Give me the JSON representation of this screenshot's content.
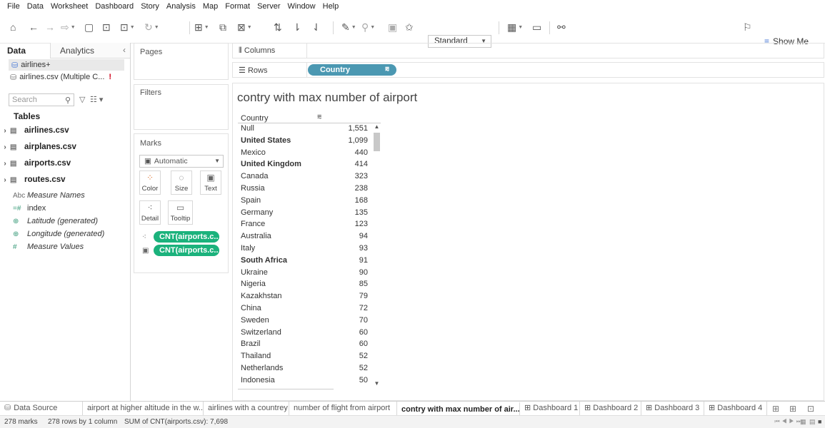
{
  "menu": [
    "File",
    "Data",
    "Worksheet",
    "Dashboard",
    "Story",
    "Analysis",
    "Map",
    "Format",
    "Server",
    "Window",
    "Help"
  ],
  "toolbar": {
    "fit_value": "Standard",
    "show_me_label": "Show Me"
  },
  "data_pane": {
    "data_tab": "Data",
    "analytics_tab": "Analytics",
    "datasources": [
      {
        "name": "airlines+"
      },
      {
        "name": "airlines.csv (Multiple C...",
        "warning": "!"
      }
    ],
    "search_placeholder": "Search",
    "tables_heading": "Tables",
    "tables": [
      "airlines.csv",
      "airplanes.csv",
      "airports.csv",
      "routes.csv"
    ],
    "fields": [
      {
        "icon": "Abc",
        "name": "Measure Names",
        "italic": true
      },
      {
        "icon": "=#",
        "name": "index",
        "italic": false
      },
      {
        "icon": "⊕",
        "name": "Latitude (generated)",
        "italic": true
      },
      {
        "icon": "⊕",
        "name": "Longitude (generated)",
        "italic": true
      },
      {
        "icon": "#",
        "name": "Measure Values",
        "italic": true
      }
    ]
  },
  "cards": {
    "pages": "Pages",
    "filters": "Filters",
    "marks": "Marks",
    "mark_type": "Automatic",
    "buttons": [
      {
        "label": "Color"
      },
      {
        "label": "Size"
      },
      {
        "label": "Text"
      },
      {
        "label": "Detail"
      },
      {
        "label": "Tooltip"
      }
    ],
    "mark_pills": [
      "CNT(airports.c..",
      "CNT(airports.c.."
    ]
  },
  "shelves": {
    "columns_label": "Columns",
    "rows_label": "Rows",
    "rows_pill": "Country"
  },
  "view": {
    "title": "contry with max number of airport",
    "column_header": "Country",
    "rows": [
      {
        "country": "Null",
        "count": "1,551",
        "bold": false
      },
      {
        "country": "United States",
        "count": "1,099",
        "bold": true
      },
      {
        "country": "Mexico",
        "count": "440",
        "bold": false
      },
      {
        "country": "United Kingdom",
        "count": "414",
        "bold": true
      },
      {
        "country": "Canada",
        "count": "323",
        "bold": false
      },
      {
        "country": "Russia",
        "count": "238",
        "bold": false
      },
      {
        "country": "Spain",
        "count": "168",
        "bold": false
      },
      {
        "country": "Germany",
        "count": "135",
        "bold": false
      },
      {
        "country": "France",
        "count": "123",
        "bold": false
      },
      {
        "country": "Australia",
        "count": "94",
        "bold": false
      },
      {
        "country": "Italy",
        "count": "93",
        "bold": false
      },
      {
        "country": "South Africa",
        "count": "91",
        "bold": true
      },
      {
        "country": "Ukraine",
        "count": "90",
        "bold": false
      },
      {
        "country": "Nigeria",
        "count": "85",
        "bold": false
      },
      {
        "country": "Kazakhstan",
        "count": "79",
        "bold": false
      },
      {
        "country": "China",
        "count": "72",
        "bold": false
      },
      {
        "country": "Sweden",
        "count": "70",
        "bold": false
      },
      {
        "country": "Switzerland",
        "count": "60",
        "bold": false
      },
      {
        "country": "Brazil",
        "count": "60",
        "bold": false
      },
      {
        "country": "Thailand",
        "count": "52",
        "bold": false
      },
      {
        "country": "Netherlands",
        "count": "52",
        "bold": false
      },
      {
        "country": "Indonesia",
        "count": "50",
        "bold": false
      }
    ]
  },
  "sheet_tabs": [
    {
      "label": "Data Source",
      "icon": "🛢",
      "active": false
    },
    {
      "label": "airport at higher altitude in the w...",
      "active": false
    },
    {
      "label": "airlines with a countrey",
      "active": false
    },
    {
      "label": "number of flight from airport",
      "active": false
    },
    {
      "label": "contry with max number of air...",
      "active": true
    },
    {
      "label": "⊞ Dashboard 1",
      "active": false
    },
    {
      "label": "⊞ Dashboard 2",
      "active": false
    },
    {
      "label": "⊞ Dashboard 3",
      "active": false
    },
    {
      "label": "⊞ Dashboard 4",
      "active": false
    }
  ],
  "status": {
    "marks": "278 marks",
    "rows": "278 rows by 1 column",
    "sum": "SUM of CNT(airports.csv): 7,698"
  }
}
